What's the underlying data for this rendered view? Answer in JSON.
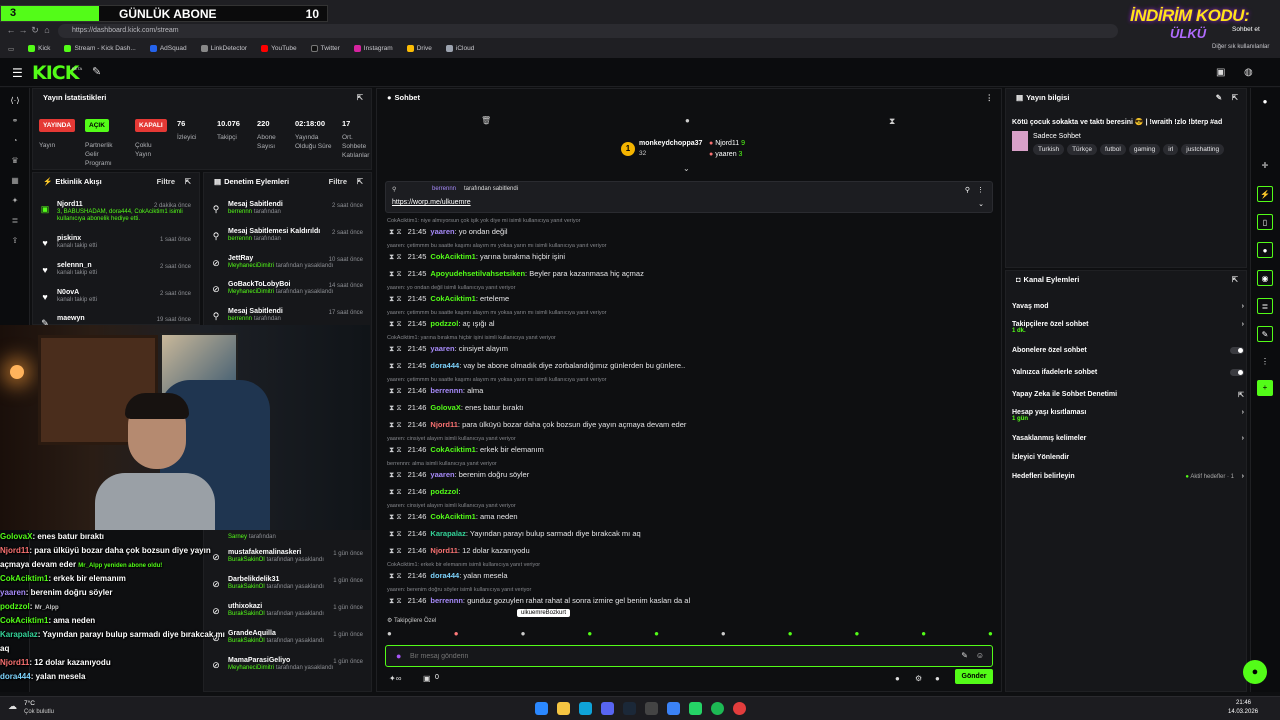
{
  "overlay_bar": {
    "left_num": "3",
    "title": "GÜNLÜK ABONE",
    "count": "10"
  },
  "browser": {
    "url": "https://dashboard.kick.com/stream",
    "bookmarks": [
      "Kick",
      "Stream - Kick Dash...",
      "AdSquad",
      "LinkDetector",
      "YouTube",
      "Twitter",
      "Instagram",
      "Drive",
      "iCloud"
    ],
    "other_bookmarks": "Diğer sık kullanılanlar",
    "profile_label": "Sohbet et",
    "promo_line1": "İNDİRİM KODU:",
    "promo_line2": "ÜLKÜ"
  },
  "header": {
    "logo": "KICK",
    "logo_badge": "BETA"
  },
  "stats": {
    "title": "Yayın İstatistikleri",
    "pills": [
      {
        "value": "YAYINDA",
        "label": "Yayın",
        "color": "#e53935"
      },
      {
        "value": "AÇIK",
        "label": "Partnerlik Gelir Programı",
        "color": "#53fc18"
      },
      {
        "value": "KAPALI",
        "label": "Çoklu Yayın",
        "color": "#e53935"
      }
    ],
    "numbers": [
      {
        "value": "76",
        "label": "İzleyici"
      },
      {
        "value": "10.076",
        "label": "Takipçi"
      },
      {
        "value": "220",
        "label": "Abone Sayısı"
      },
      {
        "value": "02:18:00",
        "label": "Yayında Olduğu Süre"
      },
      {
        "value": "17",
        "label": "Ort. Sohbete Katılanlar"
      }
    ]
  },
  "activity": {
    "title": "Etkinlik Akışı",
    "filter": "Filtre",
    "items": [
      {
        "name": "Njord11",
        "time": "2 dakika önce",
        "detail": "3, BABUSHADAM, dora444, CokAciktim1 isimli kullanıcıya abonelik hediye etti."
      },
      {
        "name": "piskinx",
        "time": "1 saat önce",
        "detail": "kanalı takip etti"
      },
      {
        "name": "selennn_n",
        "time": "2 saat önce",
        "detail": "kanalı takip etti"
      },
      {
        "name": "N0ovA",
        "time": "2 saat önce",
        "detail": "kanalı takip etti"
      },
      {
        "name": "maewyn",
        "time": "19 saat önce",
        "detail": ""
      }
    ]
  },
  "moderation": {
    "title": "Denetim Eylemleri",
    "filter": "Filtre",
    "items": [
      {
        "action": "Mesaj Sabitlendi",
        "by": "berrennn",
        "suffix": "tarafından",
        "time": "2 saat önce"
      },
      {
        "action": "Mesaj Sabitlemesi Kaldırıldı",
        "by": "berrennn",
        "suffix": "tarafından",
        "time": "2 saat önce"
      },
      {
        "action": "JettRay",
        "by": "MeyhaneciDimitri",
        "suffix": "tarafından yasaklandı",
        "time": "10 saat önce"
      },
      {
        "action": "GoBackToLobyBoi",
        "by": "MeyhaneciDimitri",
        "suffix": "tarafından yasaklandı",
        "time": "14 saat önce"
      },
      {
        "action": "Mesaj Sabitlendi",
        "by": "berrennn",
        "suffix": "tarafından",
        "time": "17 saat önce"
      }
    ],
    "lower_items": [
      {
        "action": "Sarney",
        "by": "",
        "suffix": "tarafından",
        "time": ""
      },
      {
        "action": "mustafakemalinaskeri",
        "by": "BurakSakinOl",
        "suffix": "tarafından yasaklandı",
        "time": "1 gün önce"
      },
      {
        "action": "Darbelikdelik31",
        "by": "BurakSakinOl",
        "suffix": "tarafından yasaklandı",
        "time": "1 gün önce"
      },
      {
        "action": "uthixokazi",
        "by": "BurakSakinOl",
        "suffix": "tarafından yasaklandı",
        "time": "1 gün önce"
      },
      {
        "action": "GrandeAquilla",
        "by": "BurakSakinOl",
        "suffix": "tarafından yasaklandı",
        "time": "1 gün önce"
      },
      {
        "action": "MamaParasiGeliyo",
        "by": "MeyhaneciDimitri",
        "suffix": "tarafından yasaklandı",
        "time": "1 gün önce"
      }
    ]
  },
  "overlay_chat": [
    {
      "user": "GolovaX",
      "text": ": enes batur bıraktı"
    },
    {
      "user": "Njord11",
      "text": ": para ülküyü bozar daha çok bozsun diye yayın"
    },
    {
      "user": "",
      "text": "açmaya devam eder"
    },
    {
      "user": "CokAciktim1",
      "text": ": erkek bir elemanım"
    },
    {
      "user": "yaaren",
      "text": ": berenim doğru söyler"
    },
    {
      "user": "podzzol",
      "text": ":"
    },
    {
      "user": "CokAciktim1",
      "text": ": ama neden"
    },
    {
      "user": "Karapalaz",
      "text": ": Yayından parayı bulup sarmadı diye bırakcak mı"
    },
    {
      "user": "",
      "text": "aq"
    },
    {
      "user": "Njord11",
      "text": ": 12 dolar kazanıyodu"
    },
    {
      "user": "dora444",
      "text": ": yalan mesela"
    }
  ],
  "overlay_extras": {
    "sub_msg": "Mr_Alpp yeniden abone oldu!",
    "ai_label": "9 aylık abone oldular",
    "mr_alpp": "Mr_Alpp"
  },
  "chat": {
    "title": "Sohbet",
    "top_gifters": [
      {
        "name": "monkeydchoppa37",
        "count": "32"
      },
      {
        "name": "Njord11",
        "count": "9"
      },
      {
        "name": "yaaren",
        "count": "3"
      }
    ],
    "pinned": {
      "by": "berrennn",
      "by_suffix": "tarafından sabitlendi",
      "link": "https://worp.me/ulkuemre"
    },
    "messages": [
      {
        "reply": "CokAciktim1: niye almıyorsun çok işik yok diye mi isimli kullanıcıya yanıt veriyor",
        "time": "21:45",
        "user": "yaaren",
        "color": "#a78bfa",
        "text": ": yo ondan değil"
      },
      {
        "reply": "yaaren: çetimmm bu saatte kaşımı alayım mı yoksa yarın mı isimli kullanıcıya yanıt veriyor",
        "time": "21:45",
        "user": "CokAciktim1",
        "color": "#53fc18",
        "text": ": yarına bırakma hiçbir işini"
      },
      {
        "reply": "",
        "time": "21:45",
        "user": "Apoyudehsetilvahsetsiken",
        "color": "#53fc18",
        "text": ": Beyler para kazanmasa hiç açmaz"
      },
      {
        "reply": "yaaren: yo ondan değil isimli kullanıcıya yanıt veriyor",
        "time": "21:45",
        "user": "CokAciktim1",
        "color": "#53fc18",
        "text": ": erteleme"
      },
      {
        "reply": "yaaren: çetimmm bu saatte kaşımı alayım mı yoksa yarın mı isimli kullanıcıya yanıt veriyor",
        "time": "21:45",
        "user": "podzzol",
        "color": "#53fc18",
        "text": ": aç ışığı al"
      },
      {
        "reply": "CokAciktim1: yarına bırakma hiçbir işini isimli kullanıcıya yanıt veriyor",
        "time": "21:45",
        "user": "yaaren",
        "color": "#a78bfa",
        "text": ": cinsiyet alayım"
      },
      {
        "reply": "",
        "time": "21:45",
        "user": "dora444",
        "color": "#7dd3fc",
        "text": ": vay be abone olmadık diye zorbalandığımız günlerden bu günlere.."
      },
      {
        "reply": "yaaren: çetimmm bu saatte kaşımı alayım mı yoksa yarın mı isimli kullanıcıya yanıt veriyor",
        "time": "21:46",
        "user": "berrennn",
        "color": "#a78bfa",
        "text": ": alma"
      },
      {
        "reply": "",
        "time": "21:46",
        "user": "GolovaX",
        "color": "#53fc18",
        "text": ": enes batur bıraktı"
      },
      {
        "reply": "",
        "time": "21:46",
        "user": "Njord11",
        "color": "#f87171",
        "text": ": para ülküyü bozar daha çok bozsun diye yayın açmaya devam eder"
      },
      {
        "reply": "yaaren: cinsiyet alayım isimli kullanıcıya yanıt veriyor",
        "time": "21:46",
        "user": "CokAciktim1",
        "color": "#53fc18",
        "text": ": erkek bir elemanım"
      },
      {
        "reply": "berrennn: alma isimli kullanıcıya yanıt veriyor",
        "time": "21:46",
        "user": "yaaren",
        "color": "#a78bfa",
        "text": ": berenim doğru söyler"
      },
      {
        "reply": "",
        "time": "21:46",
        "user": "podzzol",
        "color": "#53fc18",
        "text": ":"
      },
      {
        "reply": "yaaren: cinsiyet alayım isimli kullanıcıya yanıt veriyor",
        "time": "21:46",
        "user": "CokAciktim1",
        "color": "#53fc18",
        "text": ": ama neden"
      },
      {
        "reply": "",
        "time": "21:46",
        "user": "Karapalaz",
        "color": "#34d399",
        "text": ": Yayından parayı bulup sarmadı diye bırakcak mı aq"
      },
      {
        "reply": "",
        "time": "21:46",
        "user": "Njord11",
        "color": "#f87171",
        "text": ": 12 dolar kazanıyodu"
      },
      {
        "reply": "CokAciktim1: erkek bir elemanım isimli kullanıcıya yanıt veriyor",
        "time": "21:46",
        "user": "dora444",
        "color": "#7dd3fc",
        "text": ": yalan mesela"
      },
      {
        "reply": "yaaren: berenim doğru söyler isimli kullanıcıya yanıt veriyor",
        "time": "21:46",
        "user": "berrennn",
        "color": "#a78bfa",
        "text": ": gunduz gozuylen rahat rahat al sonra izmire gel benim kasları da al"
      }
    ],
    "followers_only": "Takipçilere Özel",
    "tooltip": "ulkuemreBozkurt",
    "input_placeholder": "Bir mesaj gönderin",
    "send": "Gönder",
    "bottom_count": "0"
  },
  "stream_info": {
    "title": "Yayın bilgisi",
    "stream_title": "Kötü çocuk sokakta ve taktı beresini 😎 | !wraith !zlo !bterp #ad",
    "category": "Sadece Sohbet",
    "tags": [
      "Turkish",
      "Türkçe",
      "futbol",
      "gaming",
      "irl",
      "justchatting"
    ]
  },
  "channel_actions": {
    "title": "Kanal Eylemleri",
    "items": [
      {
        "label": "Yavaş mod",
        "sub": "",
        "kind": "chevron"
      },
      {
        "label": "Takipçilere özel sohbet",
        "sub": "1 dk.",
        "kind": "chevron"
      },
      {
        "label": "Abonelere özel sohbet",
        "sub": "",
        "kind": "toggle"
      },
      {
        "label": "Yalnızca ifadelerle sohbet",
        "sub": "",
        "kind": "toggle"
      },
      {
        "label": "Yapay Zeka ile Sohbet Denetimi",
        "sub": "",
        "kind": "link"
      },
      {
        "label": "Hesap yaşı kısıtlaması",
        "sub": "1 gün",
        "kind": "chevron"
      },
      {
        "label": "Yasaklanmış kelimeler",
        "sub": "",
        "kind": "chevron"
      },
      {
        "label": "İzleyici Yönlendir",
        "sub": "",
        "kind": "none"
      },
      {
        "label": "Hedefleri belirleyin",
        "sub": "",
        "kind": "chevron"
      }
    ],
    "active_goals": "Aktif hedefler · 1"
  },
  "taskbar": {
    "weather_temp": "7°C",
    "weather_desc": "Çok bulutlu",
    "time": "21:46",
    "date": "14.03.2026"
  }
}
